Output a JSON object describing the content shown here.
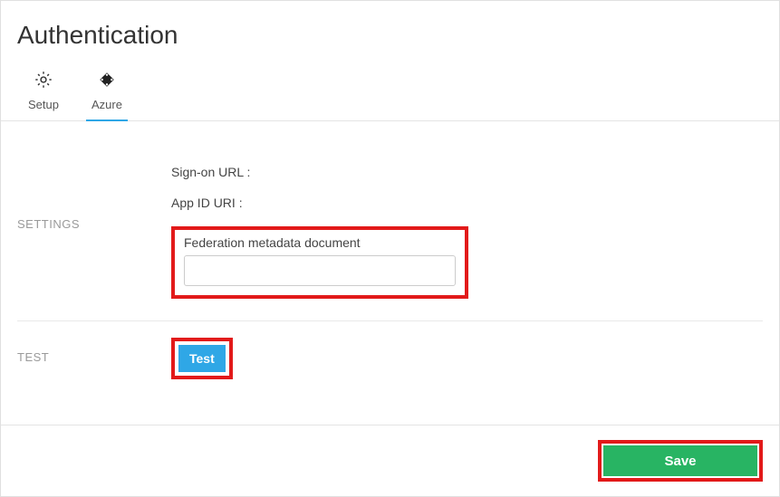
{
  "page": {
    "title": "Authentication"
  },
  "tabs": {
    "setup": {
      "label": "Setup"
    },
    "azure": {
      "label": "Azure"
    }
  },
  "sections": {
    "settings": {
      "heading": "SETTINGS",
      "signon_label": "Sign-on URL :",
      "appid_label": "App ID URI :",
      "fed_label": "Federation metadata document",
      "fed_value": ""
    },
    "test": {
      "heading": "TEST",
      "test_btn_label": "Test"
    }
  },
  "footer": {
    "save_label": "Save"
  }
}
